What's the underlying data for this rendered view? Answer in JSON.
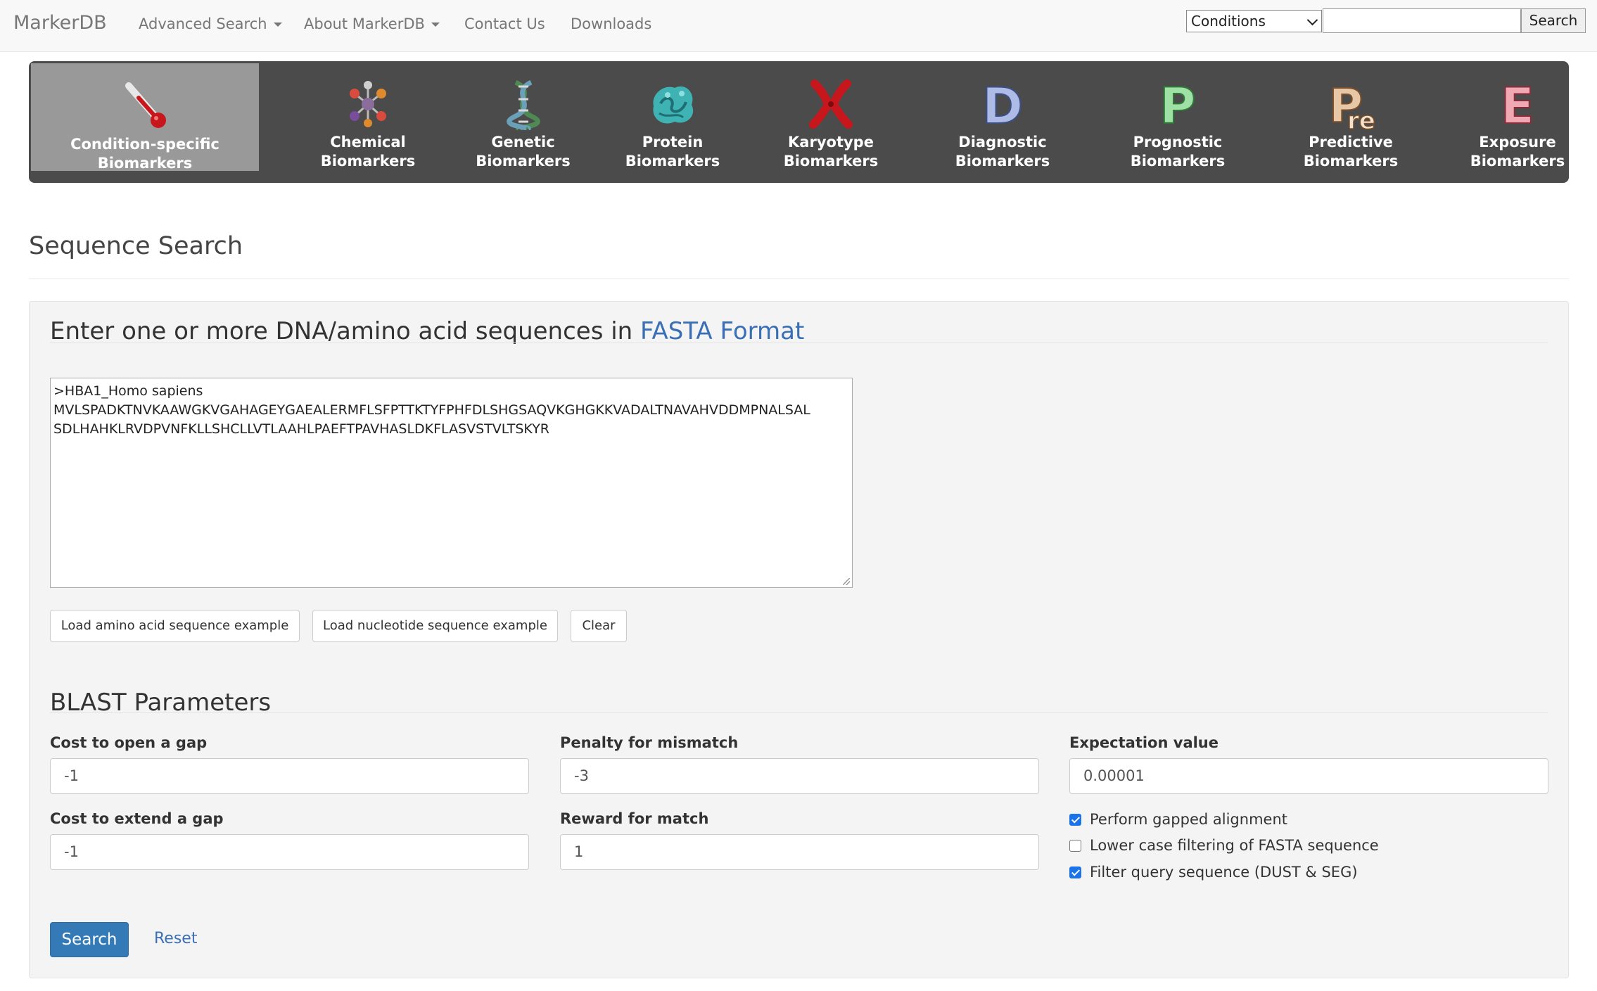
{
  "navbar": {
    "brand": "MarkerDB",
    "links": [
      "Advanced Search",
      "About MarkerDB",
      "Contact Us",
      "Downloads"
    ],
    "search_category": "Conditions",
    "search_value": "",
    "search_button": "Search"
  },
  "categories": [
    {
      "line1": "Condition-specific",
      "line2": "Biomarkers",
      "icon": "thermometer-icon",
      "active": true
    },
    {
      "line1": "Chemical",
      "line2": "Biomarkers",
      "icon": "molecule-icon"
    },
    {
      "line1": "Genetic",
      "line2": "Biomarkers",
      "icon": "dna-helix-icon"
    },
    {
      "line1": "Protein",
      "line2": "Biomarkers",
      "icon": "protein-structure-icon"
    },
    {
      "line1": "Karyotype",
      "line2": "Biomarkers",
      "icon": "chromosome-icon"
    },
    {
      "line1": "Diagnostic",
      "line2": "Biomarkers",
      "icon": "letter-d-icon",
      "letter": "D"
    },
    {
      "line1": "Prognostic",
      "line2": "Biomarkers",
      "icon": "letter-p-icon",
      "letter": "P"
    },
    {
      "line1": "Predictive",
      "line2": "Biomarkers",
      "icon": "letters-pre-icon",
      "letter": "Pre"
    },
    {
      "line1": "Exposure",
      "line2": "Biomarkers",
      "icon": "letter-e-icon",
      "letter": "E"
    }
  ],
  "colors": {
    "accent_blue": "#337ab7",
    "link_blue": "#3a6fb5",
    "category_bar": "#4b4b4b",
    "category_active": "#999999",
    "diagnostic_letter": "#aebbe6",
    "prognostic_letter": "#9fe0a4",
    "predictive_letter": "#e8c7a6",
    "exposure_letter": "#f0a9b3"
  },
  "page": {
    "title": "Sequence Search"
  },
  "sequence_form": {
    "title_prefix": "Enter one or more DNA/amino acid sequences in ",
    "title_link": "FASTA Format",
    "sequence_text": ">HBA1_Homo sapiens\nMVLSPADKTNVKAAWGKVGAHAGEYGAEALERMFLSFPTTKTYFPHFDLSHGSAQVKGHGKKVADALTNAVAHVDDMPNALSAL\nSDLHAHKLRVDPVNFKLLSHCLLVTLAAHLPAEFTPAVHASLDKFLASVSTVLTSKYR",
    "buttons": {
      "load_amino": "Load amino acid sequence example",
      "load_nucleotide": "Load nucleotide sequence example",
      "clear": "Clear"
    }
  },
  "blast": {
    "title": "BLAST Parameters",
    "gap_open_label": "Cost to open a gap",
    "gap_open_value": "-1",
    "gap_extend_label": "Cost to extend a gap",
    "gap_extend_value": "-1",
    "mismatch_label": "Penalty for mismatch",
    "mismatch_value": "-3",
    "match_label": "Reward for match",
    "match_value": "1",
    "evalue_label": "Expectation value",
    "evalue_value": "0.00001",
    "options": [
      {
        "label": "Perform gapped alignment",
        "checked": true
      },
      {
        "label": "Lower case filtering of FASTA sequence",
        "checked": false
      },
      {
        "label": "Filter query sequence (DUST & SEG)",
        "checked": true
      }
    ]
  },
  "actions": {
    "search": "Search",
    "reset": "Reset"
  }
}
